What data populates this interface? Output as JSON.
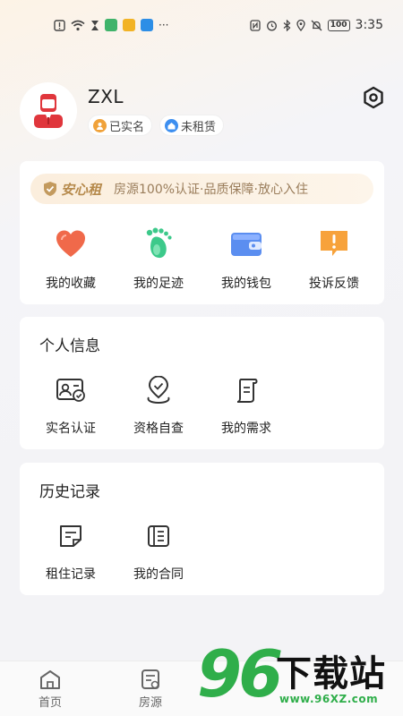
{
  "status_bar": {
    "time": "3:35",
    "battery": "100",
    "icons_left": [
      "alert-icon",
      "wifi-icon",
      "hourglass-icon",
      "app-green-icon",
      "app-yellow-icon",
      "app-blue-icon",
      "more-dots-icon"
    ],
    "icons_right": [
      "nfc-icon",
      "alarm-icon",
      "bluetooth-icon",
      "location-icon",
      "mute-icon",
      "battery-icon"
    ],
    "more": "···"
  },
  "profile": {
    "username": "ZXL",
    "badge_verified": "已实名",
    "badge_rent": "未租赁"
  },
  "anxin": {
    "brand": "安心租",
    "slogan": "房源100%认证·品质保障·放心入住"
  },
  "quick_actions": [
    {
      "label": "我的收藏",
      "icon": "heart-icon"
    },
    {
      "label": "我的足迹",
      "icon": "footprint-icon"
    },
    {
      "label": "我的钱包",
      "icon": "wallet-icon"
    },
    {
      "label": "投诉反馈",
      "icon": "complaint-icon"
    }
  ],
  "personal_info": {
    "title": "个人信息",
    "items": [
      {
        "label": "实名认证",
        "icon": "id-card-icon"
      },
      {
        "label": "资格自查",
        "icon": "qualification-icon"
      },
      {
        "label": "我的需求",
        "icon": "scroll-icon"
      }
    ]
  },
  "history": {
    "title": "历史记录",
    "items": [
      {
        "label": "租住记录",
        "icon": "record-icon"
      },
      {
        "label": "我的合同",
        "icon": "contract-icon"
      }
    ]
  },
  "tabs": [
    {
      "label": "首页",
      "icon": "home-icon"
    },
    {
      "label": "房源",
      "icon": "listing-icon"
    }
  ],
  "watermark": {
    "digits": "96",
    "text": "下载站",
    "url": "www.96XZ.com"
  },
  "colors": {
    "accent_gold": "#b68a4c",
    "watermark_green": "#2fae4a",
    "avatar_red": "#e0363c"
  }
}
